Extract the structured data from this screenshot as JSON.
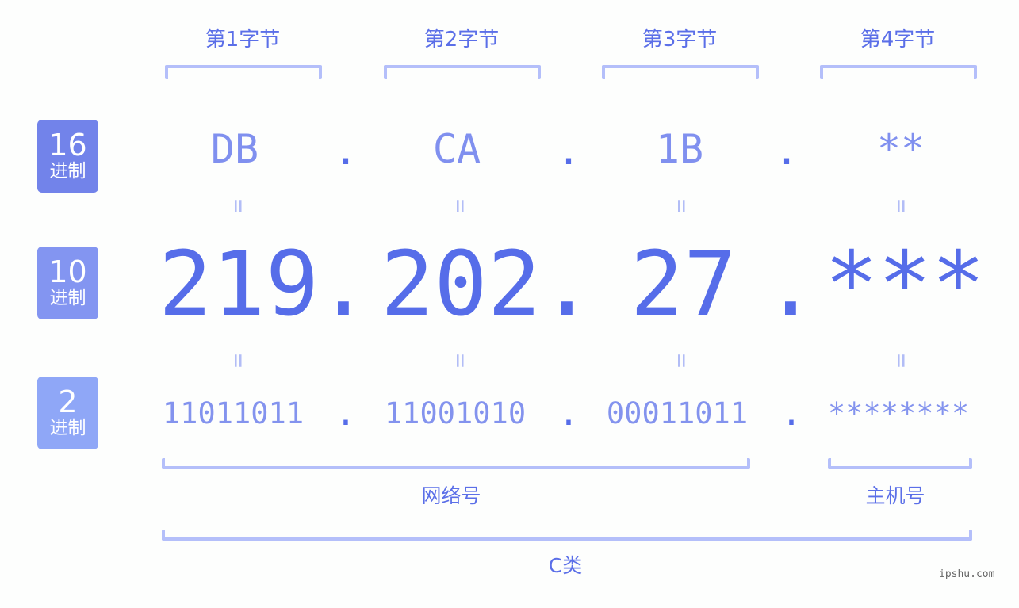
{
  "bytes": [
    {
      "label": "第1字节",
      "hex": "DB",
      "dec": "219",
      "bin": "11011011"
    },
    {
      "label": "第2字节",
      "hex": "CA",
      "dec": "202",
      "bin": "11001010"
    },
    {
      "label": "第3字节",
      "hex": "1B",
      "dec": "27",
      "bin": "00011011"
    },
    {
      "label": "第4字节",
      "hex": "**",
      "dec": "***",
      "bin": "********"
    }
  ],
  "rows": [
    {
      "base": "16",
      "unit": "进制",
      "color": "#7283ea"
    },
    {
      "base": "10",
      "unit": "进制",
      "color": "#8395f1"
    },
    {
      "base": "2",
      "unit": "进制",
      "color": "#8fa7f7"
    }
  ],
  "separator": ".",
  "equals": "=",
  "groups": {
    "network": "网络号",
    "host": "主机号",
    "class": "C类"
  },
  "watermark": "ipshu.com",
  "colors": {
    "accent": "#566de9",
    "bracket": "#b4bffa",
    "equals": "#b2bdf6"
  }
}
